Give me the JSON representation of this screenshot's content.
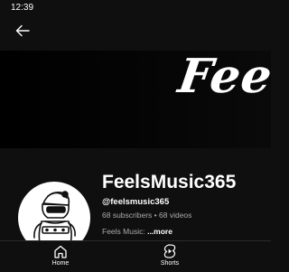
{
  "status_bar": {
    "time": "12:39"
  },
  "banner": {
    "text": "Feels"
  },
  "channel": {
    "name": "FeelsMusic365",
    "handle": "@feelsmusic365",
    "subscribers": "68 subscribers",
    "separator": "•",
    "videos": "68 videos",
    "description": "Feels Music: ",
    "more_label": "...more"
  },
  "bottom_nav": {
    "items": [
      {
        "label": "Home",
        "icon": "home-icon"
      },
      {
        "label": "Shorts",
        "icon": "shorts-icon"
      }
    ]
  }
}
